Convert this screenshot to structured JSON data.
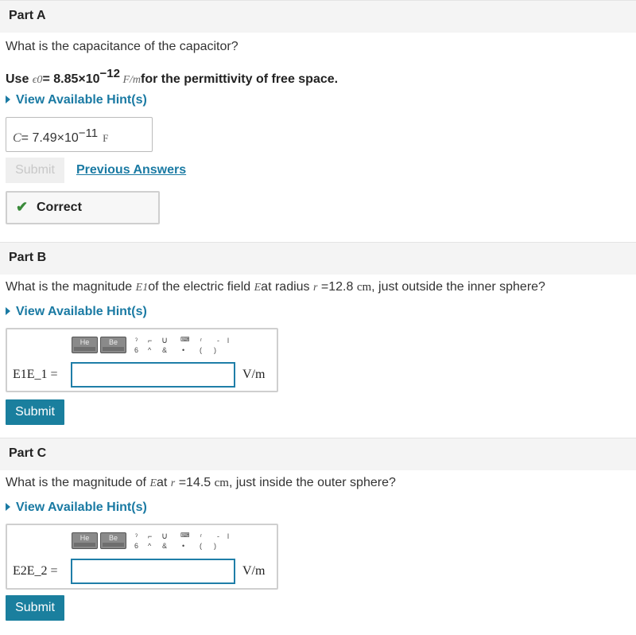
{
  "part_a": {
    "header": "Part A",
    "question": "What is the capacitance of the capacitor?",
    "use_prefix": "Use ",
    "eps_symbol": "ϵ0",
    "eps_value": "= 8.85×10",
    "eps_exponent": "−12",
    "eps_unit": " F/m",
    "eps_suffix": "for the permittivity of free space.",
    "hint": "View Available Hint(s)",
    "answer_symbol": "C",
    "answer_value": "= 7.49×10",
    "answer_exponent": "−11",
    "answer_unit": "F",
    "submit": "Submit",
    "previous_answers": "Previous Answers",
    "feedback": "Correct"
  },
  "part_b": {
    "header": "Part B",
    "q_prefix": "What is the magnitude ",
    "q_sym1": "E1",
    "q_mid": "of the electric field ",
    "q_sym2": "E",
    "q_mid2": "at radius ",
    "q_sym3": "r",
    "q_value": " =12.8 ",
    "q_unit": "cm",
    "q_suffix": ", just outside the inner sphere?",
    "hint": "View Available Hint(s)",
    "label": "E1E_1 =",
    "unit": "V/m",
    "submit": "Submit"
  },
  "part_c": {
    "header": "Part C",
    "q_prefix": "What is the magnitude of ",
    "q_sym1": "E",
    "q_mid": "at ",
    "q_sym2": "r",
    "q_value": " =14.5 ",
    "q_unit": "cm",
    "q_suffix": ", just inside the outer sphere?",
    "hint": "View Available Hint(s)",
    "label": "E2E_2 =",
    "unit": "V/m",
    "submit": "Submit"
  },
  "toolbar": {
    "key1": "He",
    "key2": "Be"
  },
  "colors": {
    "accent": "#1a7aa3",
    "submit_bg": "#1a7f9e",
    "correct_check": "#3a8a3a",
    "input_border": "#1f7ea8"
  }
}
